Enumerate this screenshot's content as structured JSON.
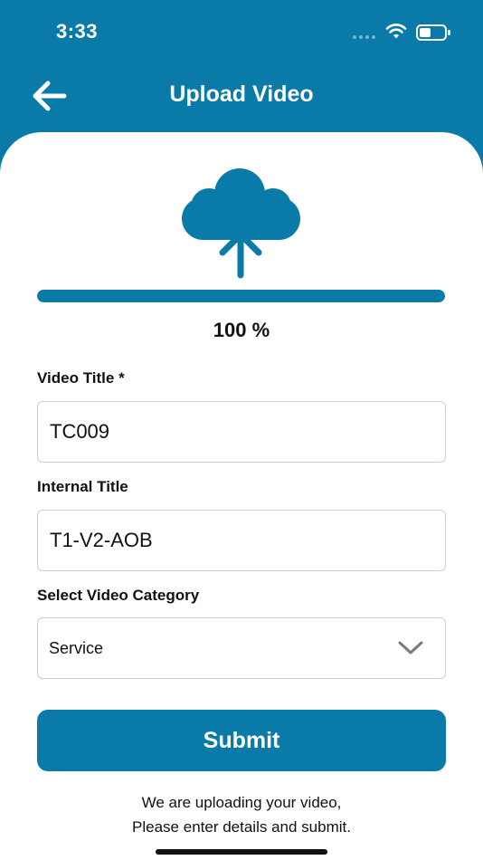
{
  "status_bar": {
    "time": "3:33"
  },
  "header": {
    "title": "Upload Video"
  },
  "upload": {
    "progress_fraction": 1.0,
    "progress_text": "100 %"
  },
  "form": {
    "video_title": {
      "label": "Video Title *",
      "value": "TC009"
    },
    "internal_title": {
      "label": "Internal Title",
      "value": "T1-V2-AOB"
    },
    "category": {
      "label": "Select Video Category",
      "selected": "Service"
    },
    "submit_label": "Submit"
  },
  "footer": {
    "line1": "We are uploading your video,",
    "line2": "Please enter details and submit."
  },
  "colors": {
    "accent": "#0a7aa8",
    "background": "#ffffff",
    "text": "#111111"
  },
  "icons": [
    "back-arrow-icon",
    "cloud-upload-icon",
    "chevron-down-icon",
    "wifi-icon",
    "battery-icon"
  ]
}
